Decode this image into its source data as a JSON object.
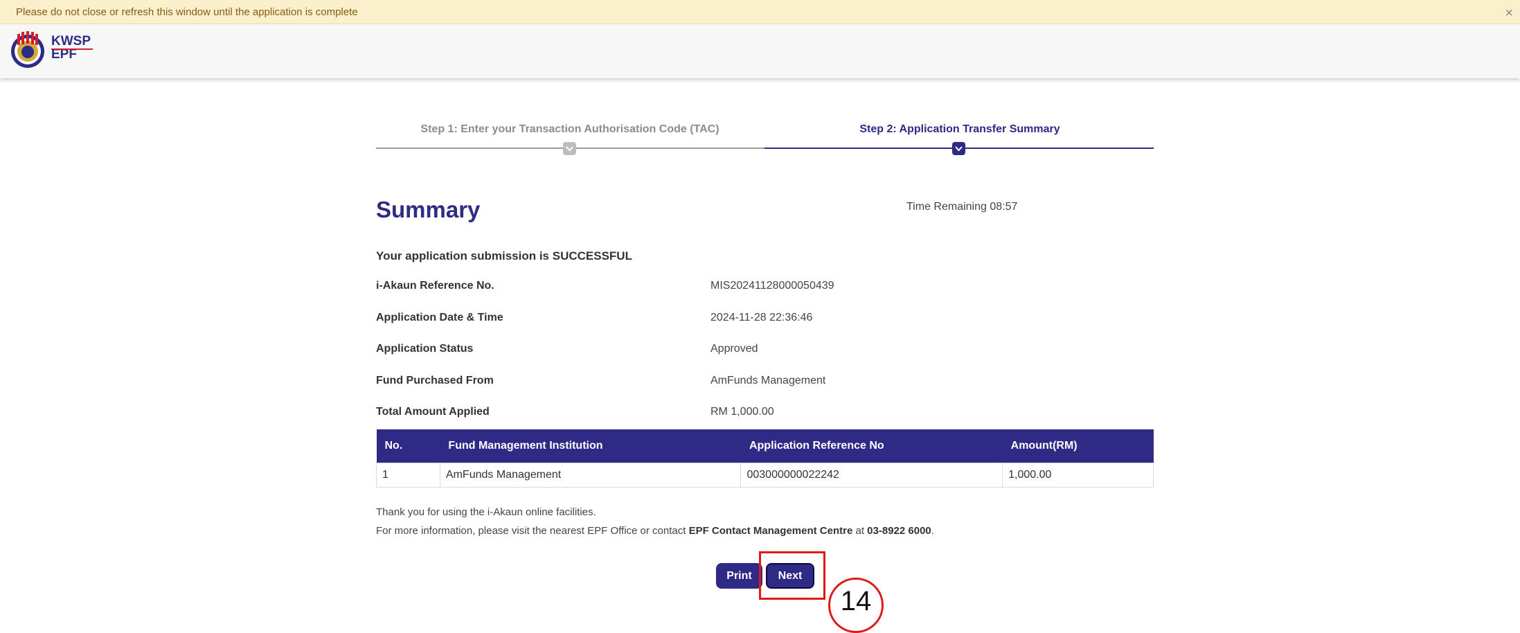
{
  "notice": {
    "text": "Please do not close or refresh this window until the application is complete",
    "close_symbol": "×"
  },
  "logo": {
    "line1": "KWSP",
    "line2": "EPF",
    "emblem_text": "KWSP"
  },
  "steps": [
    {
      "label": "Step 1: Enter your Transaction Authorisation Code (TAC)",
      "state": "done"
    },
    {
      "label": "Step 2: Application Transfer Summary",
      "state": "active"
    }
  ],
  "summary": {
    "title": "Summary",
    "timer": "Time Remaining 08:57",
    "success_prefix": "Your application submission is ",
    "success_status": "SUCCESSFUL"
  },
  "details": [
    {
      "label": "i-Akaun Reference No.",
      "value": "MIS20241128000050439"
    },
    {
      "label": "Application Date & Time",
      "value": "2024-11-28 22:36:46"
    },
    {
      "label": "Application Status",
      "value": "Approved"
    },
    {
      "label": "Fund Purchased From",
      "value": "AmFunds Management"
    },
    {
      "label": "Total Amount Applied",
      "value": "RM 1,000.00"
    }
  ],
  "table": {
    "headers": [
      "No.",
      "Fund Management Institution",
      "Application Reference No",
      "Amount(RM)"
    ],
    "rows": [
      [
        "1",
        "AmFunds Management",
        "003000000022242",
        "1,000.00"
      ]
    ]
  },
  "notes": {
    "line1": "Thank you for using the i-Akaun online facilities.",
    "line2_prefix": "For more information, please visit the nearest EPF Office or contact ",
    "line2_org": "EPF Contact Management Centre",
    "line2_mid": " at ",
    "line2_phone": "03-8922 6000",
    "line2_suffix": "."
  },
  "buttons": {
    "print": "Print",
    "next": "Next"
  },
  "annotation": {
    "step_number": "14"
  },
  "colors": {
    "primary": "#2e2a86",
    "notice_bg": "#fbf0cc",
    "highlight": "#e01818"
  }
}
